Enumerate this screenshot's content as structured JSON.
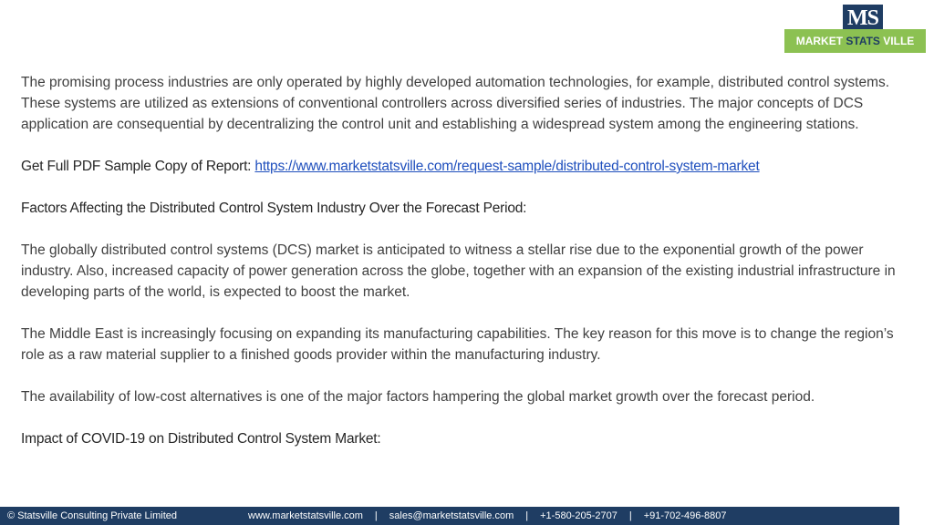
{
  "logo": {
    "mark": "MS",
    "word1": "MARKET",
    "word2": "STATS",
    "word3": "VILLE"
  },
  "intro": "The promising process industries are only operated by highly developed automation technologies, for example, distributed control systems. These systems are utilized as extensions of conventional controllers across diversified series of industries. The major concepts of DCS application are consequential by decentralizing the control unit and establishing a widespread system among the engineering stations.",
  "sample": {
    "label": "Get Full PDF Sample Copy of Report: ",
    "url": "https://www.marketstatsville.com/request-sample/distributed-control-system-market"
  },
  "heading1": "Factors Affecting the Distributed Control System Industry Over the Forecast Period:",
  "para1": "The globally distributed control systems (DCS) market is anticipated to witness a stellar rise due to the exponential growth of the power industry. Also, increased capacity of power generation across the globe, together with an expansion of the existing industrial infrastructure in developing parts of the world, is expected to boost the market.",
  "para2": "The Middle East is increasingly focusing on expanding its manufacturing capabilities. The key reason for this move is to change the region’s role as a raw material supplier to a finished goods provider within the manufacturing industry.",
  "para3": "The availability of low-cost alternatives is one of the major factors hampering the global market growth over the forecast period.",
  "heading2": "Impact of COVID-19 on Distributed Control System Market:",
  "footer": {
    "company": "© Statsville Consulting Private Limited",
    "website": "www.marketstatsville.com",
    "email": "sales@marketstatsville.com",
    "phone1": "+1-580-205-2707",
    "phone2": "+91-702-496-8807",
    "separator": "|"
  },
  "colors": {
    "navy": "#1f3d63",
    "green": "#8cc152",
    "link": "#1f4fbd",
    "text": "#404040"
  }
}
